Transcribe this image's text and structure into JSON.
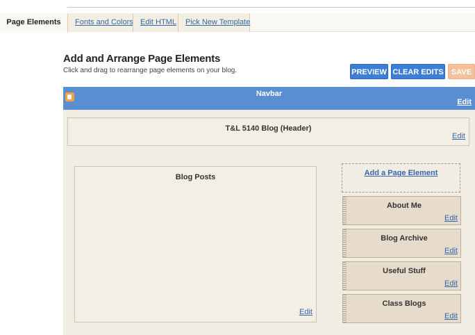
{
  "tabs": {
    "active": "Page Elements",
    "items": [
      "Fonts and Colors",
      "Edit HTML",
      "Pick New Template"
    ]
  },
  "heading": {
    "title": "Add and Arrange Page Elements",
    "subtitle": "Click and drag to rearrange page elements on your blog."
  },
  "actions": {
    "preview": "PREVIEW",
    "clear": "CLEAR EDITS",
    "save": "SAVE"
  },
  "navbar": {
    "title": "Navbar",
    "edit": "Edit"
  },
  "header": {
    "title": "T&L 5140 Blog (Header)",
    "edit": "Edit"
  },
  "posts": {
    "title": "Blog Posts",
    "edit": "Edit"
  },
  "sidebar": {
    "add_element": "Add a Page Element",
    "widgets": [
      {
        "title": "About Me",
        "edit": "Edit"
      },
      {
        "title": "Blog Archive",
        "edit": "Edit"
      },
      {
        "title": "Useful Stuff",
        "edit": "Edit"
      },
      {
        "title": "Class Blogs",
        "edit": "Edit"
      }
    ]
  },
  "colors": {
    "navbar": "#5a8ed3",
    "button_blue": "#3d7fd6",
    "save_disabled": "#f3c09a",
    "layout_bg": "#f2ede2",
    "widget_bg": "#e7dccb",
    "link": "#3366aa"
  },
  "icons": {
    "navbar_logo": "blogger-logo-icon"
  }
}
